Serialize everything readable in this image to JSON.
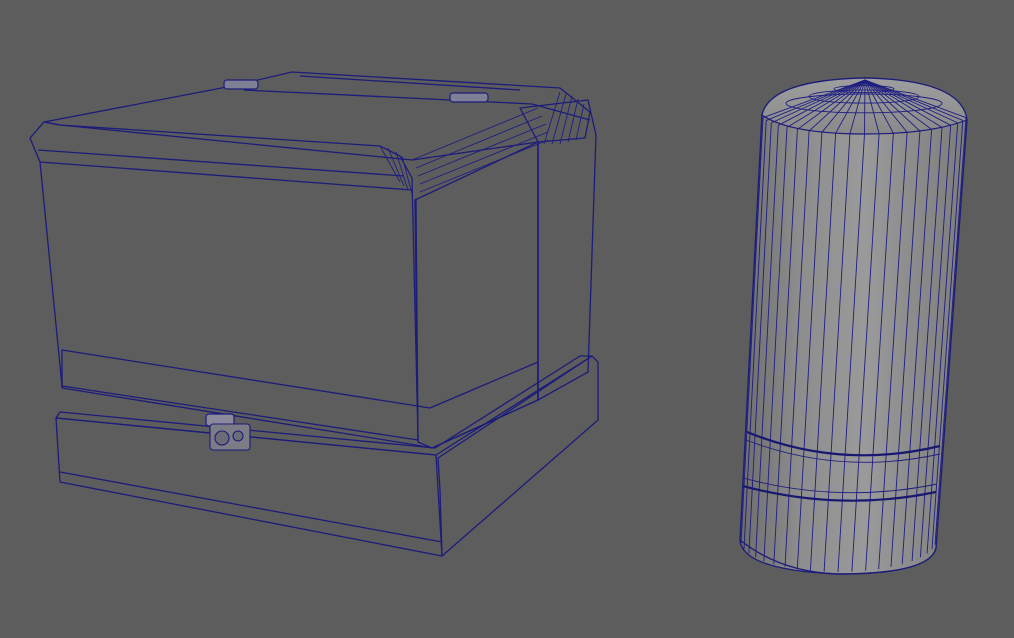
{
  "viewport": {
    "background_color": "#5d5d5d",
    "wireframe_color": "#1c1c7a",
    "objects": [
      {
        "name": "box-with-lid",
        "shading": "wireframe-on-shaded"
      },
      {
        "name": "capsule-cylinder",
        "shading": "wireframe-on-shaded"
      }
    ]
  },
  "colors": {
    "front_face": "#8a8a8a",
    "side_face": "#777777",
    "top_face": "#8e8e8e",
    "base_front": "#8c8c8c",
    "base_side": "#707070",
    "cylinder_light": "#959595",
    "cylinder_dark": "#6e6e6e"
  }
}
